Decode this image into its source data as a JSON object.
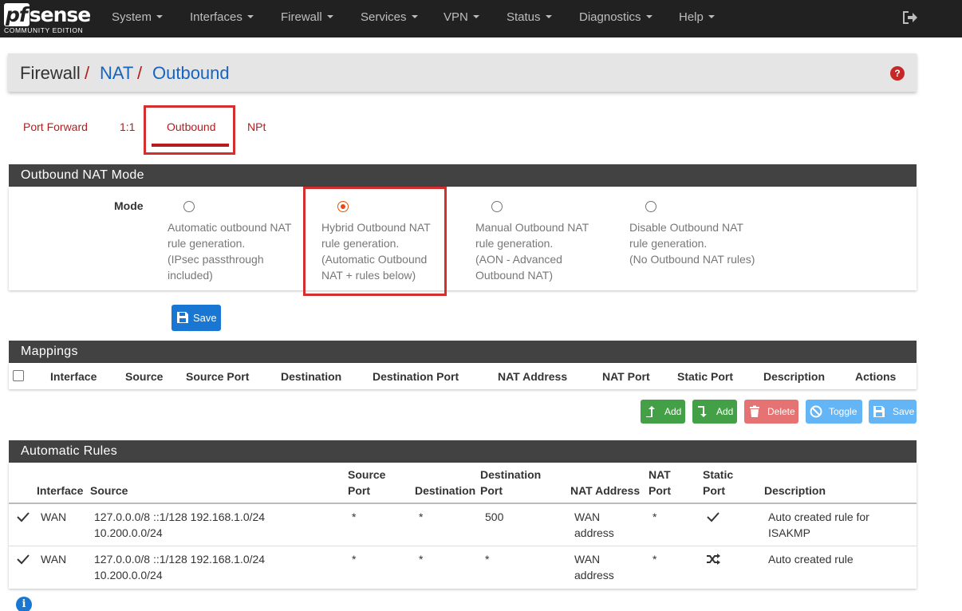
{
  "brand": {
    "logo_prefix": "pf",
    "logo_rest": "sense",
    "edition": "COMMUNITY EDITION"
  },
  "nav": {
    "items": [
      {
        "label": "System"
      },
      {
        "label": "Interfaces"
      },
      {
        "label": "Firewall"
      },
      {
        "label": "Services"
      },
      {
        "label": "VPN"
      },
      {
        "label": "Status"
      },
      {
        "label": "Diagnostics"
      },
      {
        "label": "Help"
      }
    ],
    "logout_icon": "sign-out-icon"
  },
  "breadcrumb": {
    "items": [
      "Firewall",
      "NAT",
      "Outbound"
    ],
    "separator": "/",
    "help_glyph": "?"
  },
  "tabs": [
    {
      "label": "Port Forward"
    },
    {
      "label": "1:1"
    },
    {
      "label": "Outbound",
      "active": true
    },
    {
      "label": "NPt"
    }
  ],
  "outbound_mode": {
    "title": "Outbound NAT Mode",
    "mode_label": "Mode",
    "options": [
      {
        "lines": [
          "Automatic outbound NAT",
          "rule generation.",
          "(IPsec passthrough",
          "included)"
        ],
        "checked": false
      },
      {
        "lines": [
          "Hybrid Outbound NAT",
          "rule generation.",
          "(Automatic Outbound",
          "NAT + rules below)"
        ],
        "checked": true
      },
      {
        "lines": [
          "Manual Outbound NAT",
          "rule generation.",
          "(AON - Advanced",
          "Outbound NAT)"
        ],
        "checked": false
      },
      {
        "lines": [
          "Disable Outbound NAT",
          "rule generation.",
          "(No Outbound NAT rules)"
        ],
        "checked": false
      }
    ],
    "save_label": "Save"
  },
  "mappings": {
    "title": "Mappings",
    "columns": [
      "Interface",
      "Source",
      "Source Port",
      "Destination",
      "Destination Port",
      "NAT Address",
      "NAT Port",
      "Static Port",
      "Description",
      "Actions"
    ],
    "buttons": [
      {
        "label": "Add",
        "icon": "arrow-up-icon",
        "color": "#43a047"
      },
      {
        "label": "Add",
        "icon": "arrow-down-icon",
        "color": "#43a047"
      },
      {
        "label": "Delete",
        "icon": "trash-icon",
        "color": "#e57373"
      },
      {
        "label": "Toggle",
        "icon": "ban-icon",
        "color": "#64b5f6"
      },
      {
        "label": "Save",
        "icon": "save-icon",
        "color": "#64b5f6"
      }
    ]
  },
  "automatic_rules": {
    "title": "Automatic Rules",
    "columns": {
      "interface": "Interface",
      "source": "Source",
      "source_port": [
        "Source",
        "Port"
      ],
      "destination": "Destination",
      "destination_port": [
        "Destination",
        "Port"
      ],
      "nat_address": "NAT Address",
      "nat_port": [
        "NAT",
        "Port"
      ],
      "static_port": [
        "Static",
        "Port"
      ],
      "description": "Description"
    },
    "rows": [
      {
        "enabled_icon": "check-icon",
        "interface": "WAN",
        "source": [
          "127.0.0.0/8 ::1/128 192.168.1.0/24",
          "10.200.0.0/24"
        ],
        "source_port": "*",
        "destination": "*",
        "destination_port": "500",
        "nat_address": [
          "WAN",
          "address"
        ],
        "nat_port": "*",
        "static_port_icon": "check-icon",
        "description": [
          "Auto created rule for",
          "ISAKMP"
        ]
      },
      {
        "enabled_icon": "check-icon",
        "interface": "WAN",
        "source": [
          "127.0.0.0/8 ::1/128 192.168.1.0/24",
          "10.200.0.0/24"
        ],
        "source_port": "*",
        "destination": "*",
        "destination_port": "*",
        "nat_address": [
          "WAN",
          "address"
        ],
        "nat_port": "*",
        "static_port_icon": "random-icon",
        "description": [
          "Auto created rule"
        ]
      }
    ]
  },
  "info_glyph": "i"
}
